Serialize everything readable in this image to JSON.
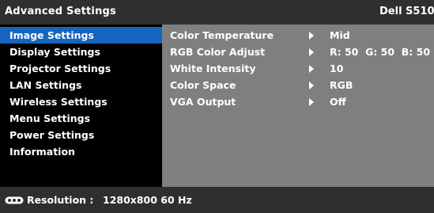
{
  "header": {
    "title": "Advanced Settings",
    "model": "Dell S510"
  },
  "sidebar": {
    "items": [
      {
        "label": "Image Settings",
        "selected": true
      },
      {
        "label": "Display Settings"
      },
      {
        "label": "Projector Settings"
      },
      {
        "label": "LAN Settings"
      },
      {
        "label": "Wireless Settings"
      },
      {
        "label": "Menu Settings"
      },
      {
        "label": "Power Settings"
      },
      {
        "label": "Information"
      }
    ]
  },
  "panel": {
    "rows": [
      {
        "label": "Color Temperature",
        "value": "Mid"
      },
      {
        "label": "RGB Color Adjust",
        "value": "R: 50  G: 50  B: 50"
      },
      {
        "label": "White Intensity",
        "value": "10"
      },
      {
        "label": "Color Space",
        "value": "RGB"
      },
      {
        "label": "VGA Output",
        "value": "Off"
      }
    ]
  },
  "status": {
    "icon": "input-source-icon",
    "label": "Resolution :",
    "value": "1280x800 60 Hz"
  },
  "colors": {
    "selected": "#1565c0",
    "panel": "#7f7f7f",
    "bars": "#2f2f2f",
    "background": "#000000"
  }
}
